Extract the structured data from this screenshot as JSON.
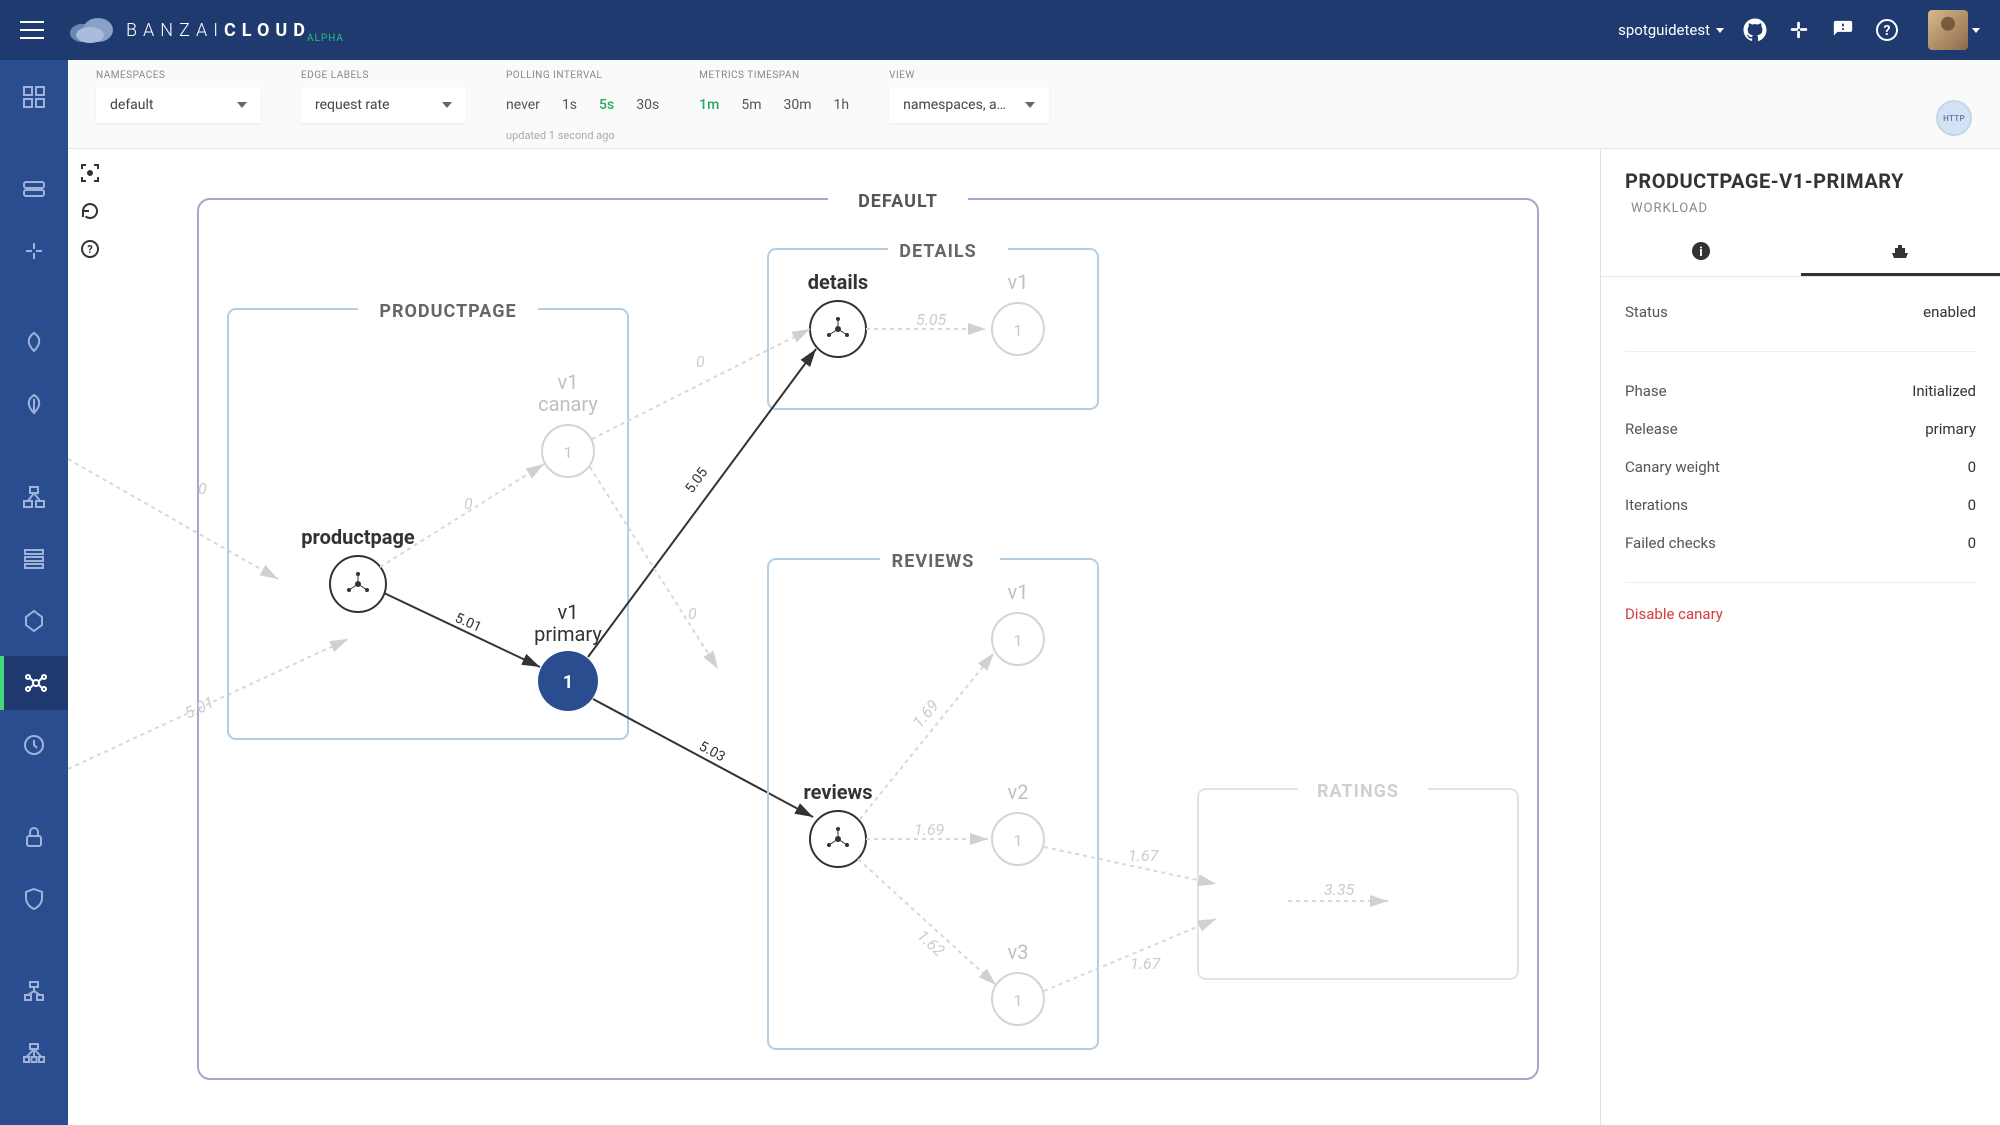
{
  "header": {
    "brand_prefix": "BANZAI",
    "brand_suffix": "CLOUD",
    "brand_tag": "ALPHA",
    "user": "spotguidetest"
  },
  "controls": {
    "namespaces_label": "NAMESPACES",
    "namespaces_value": "default",
    "edge_labels_label": "EDGE LABELS",
    "edge_labels_value": "request rate",
    "polling_label": "POLLING INTERVAL",
    "polling_options": [
      "never",
      "1s",
      "5s",
      "30s"
    ],
    "polling_selected": "5s",
    "timespan_label": "METRICS TIMESPAN",
    "timespan_options": [
      "1m",
      "5m",
      "30m",
      "1h"
    ],
    "timespan_selected": "1m",
    "view_label": "VIEW",
    "view_value": "namespaces, apps, services",
    "updated_text": "updated 1 second ago",
    "http_badge": "HTTP"
  },
  "graph": {
    "outer_title": "DEFAULT",
    "groups": {
      "productpage": "PRODUCTPAGE",
      "details": "DETAILS",
      "reviews": "REVIEWS",
      "ratings": "RATINGS"
    },
    "nodes": {
      "productpage_svc": "productpage",
      "details_svc": "details",
      "reviews_svc": "reviews",
      "v1_canary": "v1\ncanary",
      "v1_primary": "v1\nprimary",
      "details_v1": "v1",
      "reviews_v1": "v1",
      "reviews_v2": "v2",
      "reviews_v3": "v3"
    },
    "primary_value": "1",
    "edge_labels": {
      "pp_to_primary": "5.01",
      "primary_to_details": "5.05",
      "primary_to_reviews": "5.03",
      "details_to_v1": "5.05",
      "pp_to_canary_a": "0",
      "pp_to_canary_b": "0",
      "canary_to_details": "0",
      "canary_to_reviews": "0",
      "reviews_to_v1": "1.69",
      "reviews_to_v2": "1.69",
      "reviews_to_v3": "1.62",
      "v2_to_ratings": "1.67",
      "v3_to_ratings": "1.67",
      "ratings_in": "3.35",
      "ext_in": "5.01"
    },
    "ghost_node_value": "1"
  },
  "right_panel": {
    "title": "PRODUCTPAGE-V1-PRIMARY",
    "title_sub": "WORKLOAD",
    "status_label": "Status",
    "status_value": "enabled",
    "phase_label": "Phase",
    "phase_value": "Initialized",
    "release_label": "Release",
    "release_value": "primary",
    "canary_weight_label": "Canary weight",
    "canary_weight_value": "0",
    "iterations_label": "Iterations",
    "iterations_value": "0",
    "failed_checks_label": "Failed checks",
    "failed_checks_value": "0",
    "disable_action": "Disable canary"
  }
}
